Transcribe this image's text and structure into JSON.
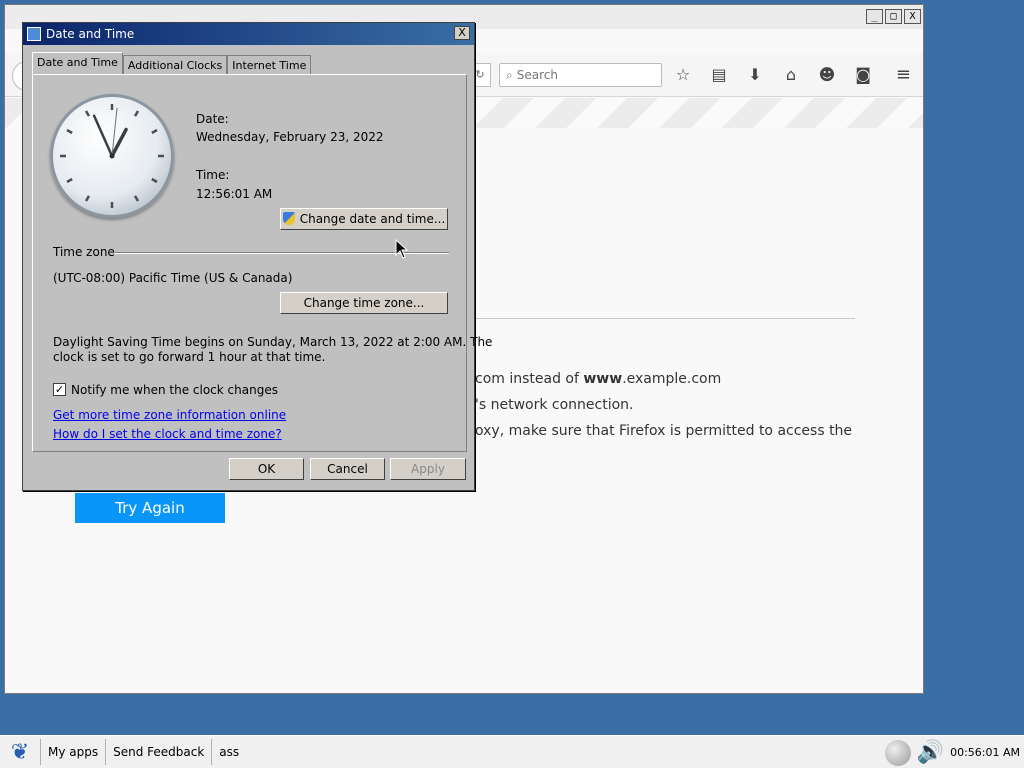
{
  "browser": {
    "search_placeholder": "Search",
    "error_lines": [
      {
        "pre": "com instead of ",
        "bold": "www",
        "post": ".example.com"
      },
      {
        "pre": "'s network connection.",
        "bold": "",
        "post": ""
      },
      {
        "pre": "oxy, make sure that Firefox is permitted to access the",
        "bold": "",
        "post": ""
      }
    ],
    "try_again": "Try Again",
    "winbtns": [
      "_",
      "□",
      "X"
    ]
  },
  "dialog": {
    "title": "Date and Time",
    "close": "X",
    "tabs": [
      {
        "label": "Date and Time",
        "active": true
      },
      {
        "label": "Additional Clocks",
        "active": false
      },
      {
        "label": "Internet Time",
        "active": false
      }
    ],
    "clock": {
      "hours": 12,
      "minutes": 56,
      "seconds": 1
    },
    "date_label": "Date:",
    "date_value": "Wednesday, February 23, 2022",
    "time_label": "Time:",
    "time_value": "12:56:01 AM",
    "change_datetime": "Change date and time...",
    "timezone_label": "Time zone",
    "timezone_value": "(UTC-08:00) Pacific Time (US & Canada)",
    "change_timezone": "Change time zone...",
    "dst_line1": "Daylight Saving Time begins on Sunday, March 13, 2022 at 2:00 AM. The",
    "dst_line2": "clock is set to go forward 1 hour at that time.",
    "notify_label": "Notify me when the clock changes",
    "notify_checked": true,
    "link1": "Get more time zone information online",
    "link2": "How do I set the clock and time zone?",
    "ok": "OK",
    "cancel": "Cancel",
    "apply": "Apply"
  },
  "taskbar": {
    "items": [
      "My apps",
      "Send Feedback",
      "ass"
    ],
    "clock": "00:56:01 AM"
  }
}
